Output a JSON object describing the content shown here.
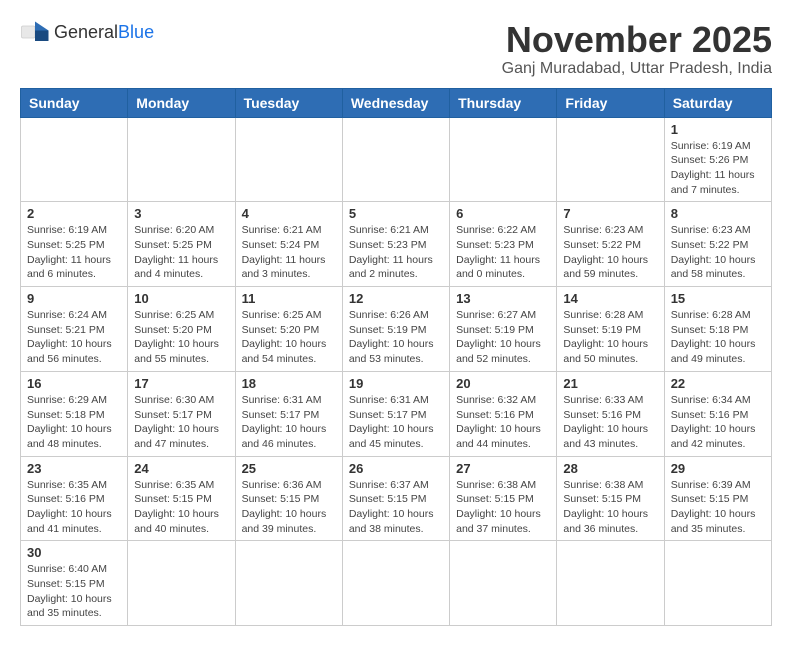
{
  "header": {
    "logo_text_general": "General",
    "logo_text_blue": "Blue",
    "month_year": "November 2025",
    "location": "Ganj Muradabad, Uttar Pradesh, India"
  },
  "days_of_week": [
    "Sunday",
    "Monday",
    "Tuesday",
    "Wednesday",
    "Thursday",
    "Friday",
    "Saturday"
  ],
  "weeks": [
    [
      {
        "day": "",
        "info": ""
      },
      {
        "day": "",
        "info": ""
      },
      {
        "day": "",
        "info": ""
      },
      {
        "day": "",
        "info": ""
      },
      {
        "day": "",
        "info": ""
      },
      {
        "day": "",
        "info": ""
      },
      {
        "day": "1",
        "info": "Sunrise: 6:19 AM\nSunset: 5:26 PM\nDaylight: 11 hours and 7 minutes."
      }
    ],
    [
      {
        "day": "2",
        "info": "Sunrise: 6:19 AM\nSunset: 5:25 PM\nDaylight: 11 hours and 6 minutes."
      },
      {
        "day": "3",
        "info": "Sunrise: 6:20 AM\nSunset: 5:25 PM\nDaylight: 11 hours and 4 minutes."
      },
      {
        "day": "4",
        "info": "Sunrise: 6:21 AM\nSunset: 5:24 PM\nDaylight: 11 hours and 3 minutes."
      },
      {
        "day": "5",
        "info": "Sunrise: 6:21 AM\nSunset: 5:23 PM\nDaylight: 11 hours and 2 minutes."
      },
      {
        "day": "6",
        "info": "Sunrise: 6:22 AM\nSunset: 5:23 PM\nDaylight: 11 hours and 0 minutes."
      },
      {
        "day": "7",
        "info": "Sunrise: 6:23 AM\nSunset: 5:22 PM\nDaylight: 10 hours and 59 minutes."
      },
      {
        "day": "8",
        "info": "Sunrise: 6:23 AM\nSunset: 5:22 PM\nDaylight: 10 hours and 58 minutes."
      }
    ],
    [
      {
        "day": "9",
        "info": "Sunrise: 6:24 AM\nSunset: 5:21 PM\nDaylight: 10 hours and 56 minutes."
      },
      {
        "day": "10",
        "info": "Sunrise: 6:25 AM\nSunset: 5:20 PM\nDaylight: 10 hours and 55 minutes."
      },
      {
        "day": "11",
        "info": "Sunrise: 6:25 AM\nSunset: 5:20 PM\nDaylight: 10 hours and 54 minutes."
      },
      {
        "day": "12",
        "info": "Sunrise: 6:26 AM\nSunset: 5:19 PM\nDaylight: 10 hours and 53 minutes."
      },
      {
        "day": "13",
        "info": "Sunrise: 6:27 AM\nSunset: 5:19 PM\nDaylight: 10 hours and 52 minutes."
      },
      {
        "day": "14",
        "info": "Sunrise: 6:28 AM\nSunset: 5:19 PM\nDaylight: 10 hours and 50 minutes."
      },
      {
        "day": "15",
        "info": "Sunrise: 6:28 AM\nSunset: 5:18 PM\nDaylight: 10 hours and 49 minutes."
      }
    ],
    [
      {
        "day": "16",
        "info": "Sunrise: 6:29 AM\nSunset: 5:18 PM\nDaylight: 10 hours and 48 minutes."
      },
      {
        "day": "17",
        "info": "Sunrise: 6:30 AM\nSunset: 5:17 PM\nDaylight: 10 hours and 47 minutes."
      },
      {
        "day": "18",
        "info": "Sunrise: 6:31 AM\nSunset: 5:17 PM\nDaylight: 10 hours and 46 minutes."
      },
      {
        "day": "19",
        "info": "Sunrise: 6:31 AM\nSunset: 5:17 PM\nDaylight: 10 hours and 45 minutes."
      },
      {
        "day": "20",
        "info": "Sunrise: 6:32 AM\nSunset: 5:16 PM\nDaylight: 10 hours and 44 minutes."
      },
      {
        "day": "21",
        "info": "Sunrise: 6:33 AM\nSunset: 5:16 PM\nDaylight: 10 hours and 43 minutes."
      },
      {
        "day": "22",
        "info": "Sunrise: 6:34 AM\nSunset: 5:16 PM\nDaylight: 10 hours and 42 minutes."
      }
    ],
    [
      {
        "day": "23",
        "info": "Sunrise: 6:35 AM\nSunset: 5:16 PM\nDaylight: 10 hours and 41 minutes."
      },
      {
        "day": "24",
        "info": "Sunrise: 6:35 AM\nSunset: 5:15 PM\nDaylight: 10 hours and 40 minutes."
      },
      {
        "day": "25",
        "info": "Sunrise: 6:36 AM\nSunset: 5:15 PM\nDaylight: 10 hours and 39 minutes."
      },
      {
        "day": "26",
        "info": "Sunrise: 6:37 AM\nSunset: 5:15 PM\nDaylight: 10 hours and 38 minutes."
      },
      {
        "day": "27",
        "info": "Sunrise: 6:38 AM\nSunset: 5:15 PM\nDaylight: 10 hours and 37 minutes."
      },
      {
        "day": "28",
        "info": "Sunrise: 6:38 AM\nSunset: 5:15 PM\nDaylight: 10 hours and 36 minutes."
      },
      {
        "day": "29",
        "info": "Sunrise: 6:39 AM\nSunset: 5:15 PM\nDaylight: 10 hours and 35 minutes."
      }
    ],
    [
      {
        "day": "30",
        "info": "Sunrise: 6:40 AM\nSunset: 5:15 PM\nDaylight: 10 hours and 35 minutes."
      },
      {
        "day": "",
        "info": ""
      },
      {
        "day": "",
        "info": ""
      },
      {
        "day": "",
        "info": ""
      },
      {
        "day": "",
        "info": ""
      },
      {
        "day": "",
        "info": ""
      },
      {
        "day": "",
        "info": ""
      }
    ]
  ]
}
